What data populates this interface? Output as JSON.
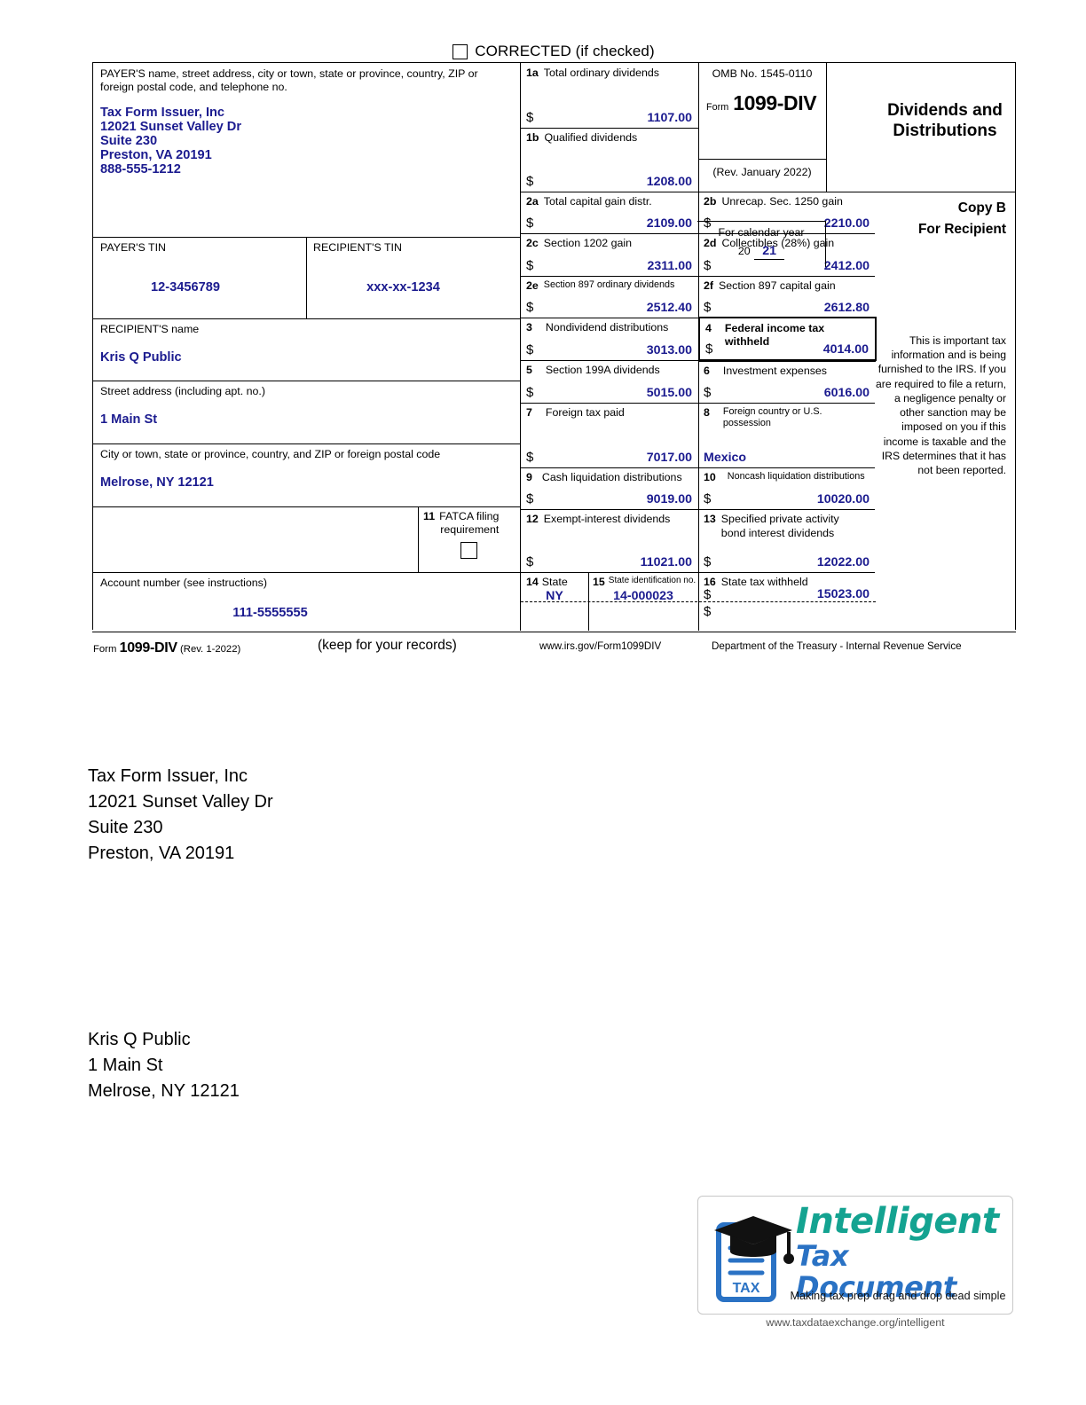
{
  "corrected": {
    "label": "CORRECTED (if checked)",
    "checked": false
  },
  "payer": {
    "caption": "PAYER'S name, street address, city or town, state or province, country, ZIP or foreign postal code, and telephone no.",
    "name": "Tax Form Issuer, Inc",
    "address1": "12021 Sunset Valley Dr",
    "address2": "Suite 230",
    "city_state_zip": "Preston, VA 20191",
    "phone": "888-555-1212",
    "tin_label": "PAYER'S TIN",
    "tin": "12-3456789"
  },
  "recipient": {
    "tin_label": "RECIPIENT'S TIN",
    "tin": "xxx-xx-1234",
    "name_label": "RECIPIENT'S name",
    "name": "Kris Q Public",
    "street_label": "Street address (including apt. no.)",
    "street": "1 Main St",
    "city_label": "City or town, state or province, country, and ZIP or foreign postal code",
    "city_state_zip": "Melrose, NY 12121"
  },
  "account": {
    "label": "Account number (see instructions)",
    "value": "111-5555555"
  },
  "fatca": {
    "number": "11",
    "label_line1": "FATCA filing",
    "label_line2": "requirement",
    "checked": false
  },
  "omb": {
    "number": "OMB No. 1545-0110",
    "form_word": "Form",
    "form_number": "1099-DIV",
    "revision": "(Rev. January 2022)",
    "calendar_year_label": "For calendar year",
    "year_prefix": "20",
    "year_suffix": "21"
  },
  "title": {
    "line1": "Dividends and",
    "line2": "Distributions"
  },
  "copy": {
    "line1": "Copy B",
    "line2": "For Recipient",
    "notice": "This is important tax information and is being furnished to the IRS. If you are required to file a return, a negligence penalty or other sanction may be imposed on you if this income is taxable and the IRS determines that it has not been reported."
  },
  "boxes": {
    "b1a": {
      "num": "1a",
      "label": "Total ordinary dividends",
      "currency": "$",
      "value": "1107.00"
    },
    "b1b": {
      "num": "1b",
      "label": "Qualified dividends",
      "currency": "$",
      "value": "1208.00"
    },
    "b2a": {
      "num": "2a",
      "label": "Total capital gain distr.",
      "currency": "$",
      "value": "2109.00"
    },
    "b2b": {
      "num": "2b",
      "label": "Unrecap. Sec. 1250 gain",
      "currency": "$",
      "value": "2210.00"
    },
    "b2c": {
      "num": "2c",
      "label": "Section 1202 gain",
      "currency": "$",
      "value": "2311.00"
    },
    "b2d": {
      "num": "2d",
      "label": "Collectibles (28%) gain",
      "currency": "$",
      "value": "2412.00"
    },
    "b2e": {
      "num": "2e",
      "label": "Section 897 ordinary dividends",
      "currency": "$",
      "value": "2512.40"
    },
    "b2f": {
      "num": "2f",
      "label": "Section 897 capital gain",
      "currency": "$",
      "value": "2612.80"
    },
    "b3": {
      "num": "3",
      "label": "Nondividend distributions",
      "currency": "$",
      "value": "3013.00"
    },
    "b4": {
      "num": "4",
      "label": "Federal income tax withheld",
      "currency": "$",
      "value": "4014.00"
    },
    "b5": {
      "num": "5",
      "label": "Section 199A dividends",
      "currency": "$",
      "value": "5015.00"
    },
    "b6": {
      "num": "6",
      "label": "Investment expenses",
      "currency": "$",
      "value": "6016.00"
    },
    "b7": {
      "num": "7",
      "label": "Foreign tax paid",
      "currency": "$",
      "value": "7017.00"
    },
    "b8": {
      "num": "8",
      "label": "Foreign country or U.S. possession",
      "value": "Mexico"
    },
    "b9": {
      "num": "9",
      "label": "Cash liquidation distributions",
      "currency": "$",
      "value": "9019.00"
    },
    "b10": {
      "num": "10",
      "label": "Noncash liquidation distributions",
      "currency": "$",
      "value": "10020.00"
    },
    "b12": {
      "num": "12",
      "label": "Exempt-interest dividends",
      "currency": "$",
      "value": "11021.00"
    },
    "b13": {
      "num": "13",
      "label_line1": "Specified private activity",
      "label_line2": "bond interest dividends",
      "currency": "$",
      "value": "12022.00"
    },
    "b14": {
      "num": "14",
      "label": "State",
      "value": "NY",
      "value2": ""
    },
    "b15": {
      "num": "15",
      "label": "State identification no.",
      "value": "14-000023",
      "value2": ""
    },
    "b16": {
      "num": "16",
      "label": "State tax withheld",
      "currency": "$",
      "value": "15023.00",
      "currency2": "$",
      "value2": ""
    }
  },
  "form_footer": {
    "form_word": "Form",
    "form_number": "1099-DIV",
    "revision": "(Rev. 1-2022)",
    "keep": "(keep for your records)",
    "url": "www.irs.gov/Form1099DIV",
    "department": "Department of the Treasury - Internal Revenue Service"
  },
  "mail": {
    "payer_block": "Tax Form Issuer, Inc\n12021 Sunset Valley Dr\nSuite 230\nPreston, VA 20191",
    "recipient_block": "Kris Q Public\n1 Main St\nMelrose, NY 12121"
  },
  "logo": {
    "word1": "Intelligent",
    "word2": "Tax Document",
    "tagline": "Making tax prep drag and drop dead simple",
    "doc_label": "TAX",
    "url": "www.taxdataexchange.org/intelligent",
    "color_teal": "#14a391",
    "color_blue": "#2a72c4"
  },
  "colors": {
    "data_blue": "#1b1b8f",
    "rule": "#000000"
  }
}
